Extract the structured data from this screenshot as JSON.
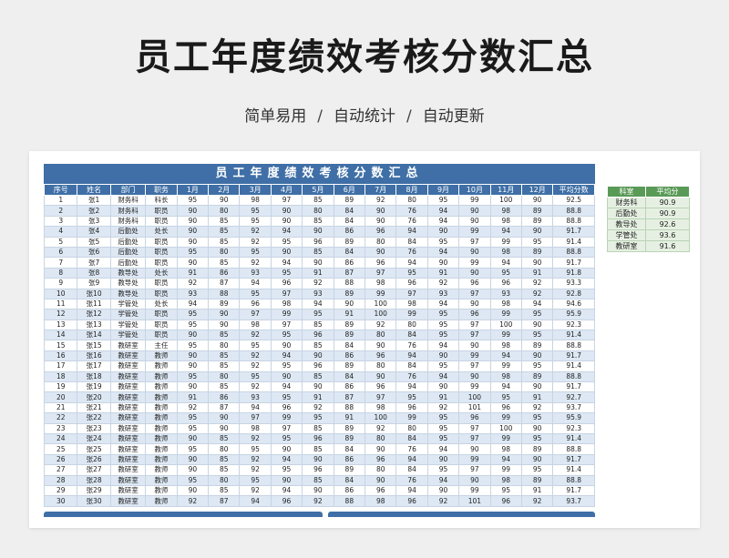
{
  "title": "员工年度绩效考核分数汇总",
  "subtitle": [
    "简单易用",
    "自动统计",
    "自动更新"
  ],
  "subtitle_sep": "/",
  "main_table": {
    "title": "员工年度绩效考核分数汇总",
    "headers": [
      "序号",
      "姓名",
      "部门",
      "职务",
      "1月",
      "2月",
      "3月",
      "4月",
      "5月",
      "6月",
      "7月",
      "8月",
      "9月",
      "10月",
      "11月",
      "12月",
      "平均分数"
    ],
    "rows": [
      [
        "1",
        "张1",
        "财务科",
        "科长",
        "95",
        "90",
        "98",
        "97",
        "85",
        "89",
        "92",
        "80",
        "95",
        "99",
        "100",
        "90",
        "92.5"
      ],
      [
        "2",
        "张2",
        "财务科",
        "职员",
        "90",
        "80",
        "95",
        "90",
        "80",
        "84",
        "90",
        "76",
        "94",
        "90",
        "98",
        "89",
        "88.8"
      ],
      [
        "3",
        "张3",
        "财务科",
        "职员",
        "90",
        "85",
        "95",
        "90",
        "85",
        "84",
        "90",
        "76",
        "94",
        "90",
        "98",
        "89",
        "88.8"
      ],
      [
        "4",
        "张4",
        "后勤处",
        "处长",
        "90",
        "85",
        "92",
        "94",
        "90",
        "86",
        "96",
        "94",
        "90",
        "99",
        "94",
        "90",
        "91.7"
      ],
      [
        "5",
        "张5",
        "后勤处",
        "职员",
        "90",
        "85",
        "92",
        "95",
        "96",
        "89",
        "80",
        "84",
        "95",
        "97",
        "99",
        "95",
        "91.4"
      ],
      [
        "6",
        "张6",
        "后勤处",
        "职员",
        "95",
        "80",
        "95",
        "90",
        "85",
        "84",
        "90",
        "76",
        "94",
        "90",
        "98",
        "89",
        "88.8"
      ],
      [
        "7",
        "张7",
        "后勤处",
        "职员",
        "90",
        "85",
        "92",
        "94",
        "90",
        "86",
        "96",
        "94",
        "90",
        "99",
        "94",
        "90",
        "91.7"
      ],
      [
        "8",
        "张8",
        "教导处",
        "处长",
        "91",
        "86",
        "93",
        "95",
        "91",
        "87",
        "97",
        "95",
        "91",
        "90",
        "95",
        "91",
        "91.8"
      ],
      [
        "9",
        "张9",
        "教导处",
        "职员",
        "92",
        "87",
        "94",
        "96",
        "92",
        "88",
        "98",
        "96",
        "92",
        "96",
        "96",
        "92",
        "93.3"
      ],
      [
        "10",
        "张10",
        "教导处",
        "职员",
        "93",
        "88",
        "95",
        "97",
        "93",
        "89",
        "99",
        "97",
        "93",
        "97",
        "93",
        "92",
        "92.8"
      ],
      [
        "11",
        "张11",
        "学管处",
        "处长",
        "94",
        "89",
        "96",
        "98",
        "94",
        "90",
        "100",
        "98",
        "94",
        "90",
        "98",
        "94",
        "94.6"
      ],
      [
        "12",
        "张12",
        "学管处",
        "职员",
        "95",
        "90",
        "97",
        "99",
        "95",
        "91",
        "100",
        "99",
        "95",
        "96",
        "99",
        "95",
        "95.9"
      ],
      [
        "13",
        "张13",
        "学管处",
        "职员",
        "95",
        "90",
        "98",
        "97",
        "85",
        "89",
        "92",
        "80",
        "95",
        "97",
        "100",
        "90",
        "92.3"
      ],
      [
        "14",
        "张14",
        "学管处",
        "职员",
        "90",
        "85",
        "92",
        "95",
        "96",
        "89",
        "80",
        "84",
        "95",
        "97",
        "99",
        "95",
        "91.4"
      ],
      [
        "15",
        "张15",
        "教研室",
        "主任",
        "95",
        "80",
        "95",
        "90",
        "85",
        "84",
        "90",
        "76",
        "94",
        "90",
        "98",
        "89",
        "88.8"
      ],
      [
        "16",
        "张16",
        "教研室",
        "教师",
        "90",
        "85",
        "92",
        "94",
        "90",
        "86",
        "96",
        "94",
        "90",
        "99",
        "94",
        "90",
        "91.7"
      ],
      [
        "17",
        "张17",
        "教研室",
        "教师",
        "90",
        "85",
        "92",
        "95",
        "96",
        "89",
        "80",
        "84",
        "95",
        "97",
        "99",
        "95",
        "91.4"
      ],
      [
        "18",
        "张18",
        "教研室",
        "教师",
        "95",
        "80",
        "95",
        "90",
        "85",
        "84",
        "90",
        "76",
        "94",
        "90",
        "98",
        "89",
        "88.8"
      ],
      [
        "19",
        "张19",
        "教研室",
        "教师",
        "90",
        "85",
        "92",
        "94",
        "90",
        "86",
        "96",
        "94",
        "90",
        "99",
        "94",
        "90",
        "91.7"
      ],
      [
        "20",
        "张20",
        "教研室",
        "教师",
        "91",
        "86",
        "93",
        "95",
        "91",
        "87",
        "97",
        "95",
        "91",
        "100",
        "95",
        "91",
        "92.7"
      ],
      [
        "21",
        "张21",
        "教研室",
        "教师",
        "92",
        "87",
        "94",
        "96",
        "92",
        "88",
        "98",
        "96",
        "92",
        "101",
        "96",
        "92",
        "93.7"
      ],
      [
        "22",
        "张22",
        "教研室",
        "教师",
        "95",
        "90",
        "97",
        "99",
        "95",
        "91",
        "100",
        "99",
        "95",
        "96",
        "99",
        "95",
        "95.9"
      ],
      [
        "23",
        "张23",
        "教研室",
        "教师",
        "95",
        "90",
        "98",
        "97",
        "85",
        "89",
        "92",
        "80",
        "95",
        "97",
        "100",
        "90",
        "92.3"
      ],
      [
        "24",
        "张24",
        "教研室",
        "教师",
        "90",
        "85",
        "92",
        "95",
        "96",
        "89",
        "80",
        "84",
        "95",
        "97",
        "99",
        "95",
        "91.4"
      ],
      [
        "25",
        "张25",
        "教研室",
        "教师",
        "95",
        "80",
        "95",
        "90",
        "85",
        "84",
        "90",
        "76",
        "94",
        "90",
        "98",
        "89",
        "88.8"
      ],
      [
        "26",
        "张26",
        "教研室",
        "教师",
        "90",
        "85",
        "92",
        "94",
        "90",
        "86",
        "96",
        "94",
        "90",
        "99",
        "94",
        "90",
        "91.7"
      ],
      [
        "27",
        "张27",
        "教研室",
        "教师",
        "90",
        "85",
        "92",
        "95",
        "96",
        "89",
        "80",
        "84",
        "95",
        "97",
        "99",
        "95",
        "91.4"
      ],
      [
        "28",
        "张28",
        "教研室",
        "教师",
        "95",
        "80",
        "95",
        "90",
        "85",
        "84",
        "90",
        "76",
        "94",
        "90",
        "98",
        "89",
        "88.8"
      ],
      [
        "29",
        "张29",
        "教研室",
        "教师",
        "90",
        "85",
        "92",
        "94",
        "90",
        "86",
        "96",
        "94",
        "90",
        "99",
        "95",
        "91",
        "91.7"
      ],
      [
        "30",
        "张30",
        "教研室",
        "教师",
        "92",
        "87",
        "94",
        "96",
        "92",
        "88",
        "98",
        "96",
        "92",
        "101",
        "96",
        "92",
        "93.7"
      ]
    ]
  },
  "summary_table": {
    "headers": [
      "科室",
      "平均分"
    ],
    "rows": [
      [
        "财务科",
        "90.9"
      ],
      [
        "后勤处",
        "90.9"
      ],
      [
        "教导处",
        "92.6"
      ],
      [
        "学管处",
        "93.6"
      ],
      [
        "教研室",
        "91.6"
      ]
    ]
  },
  "colors": {
    "header_blue": "#3f6fa6",
    "stripe_blue": "#dde8f4",
    "header_green": "#5a9a57",
    "cell_green": "#e6f0e2"
  }
}
